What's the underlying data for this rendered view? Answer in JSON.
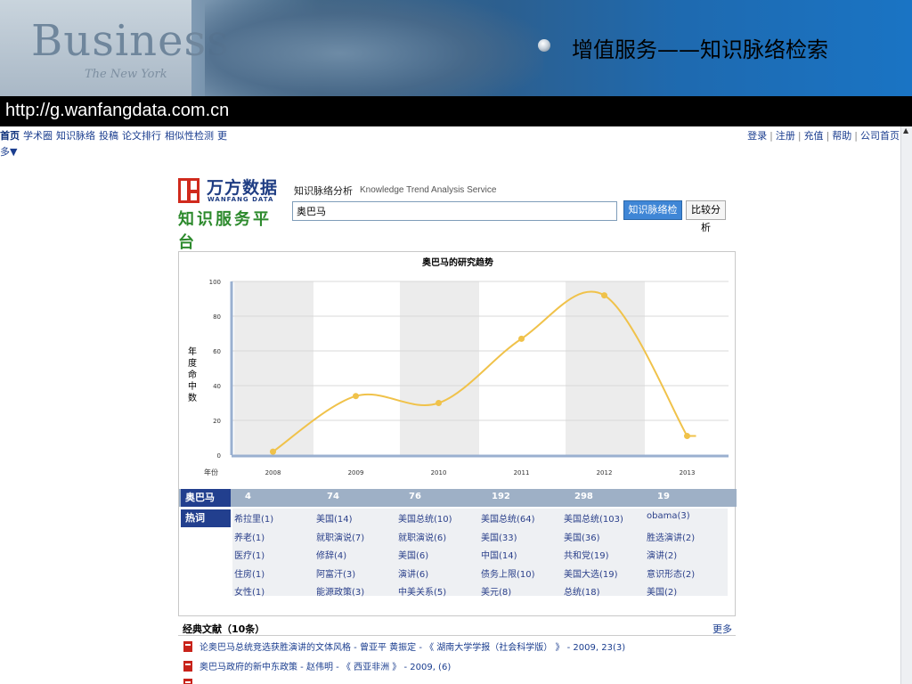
{
  "slide": {
    "banner_word": "Business",
    "banner_sub": "The New York",
    "title": "增值服务——知识脉络检索",
    "url": "http://g.wanfangdata.com.cn"
  },
  "topnav": {
    "home": "首页",
    "items": [
      "学术圈",
      "知识脉络",
      "投稿",
      "论文排行",
      "相似性检测",
      "更"
    ],
    "more_line": "多▼"
  },
  "rightnav": {
    "login": "登录",
    "register": "注册",
    "recharge": "充值",
    "help": "帮助",
    "company": "公司首页"
  },
  "logo": {
    "cn": "万方数据",
    "en": "WANFANG DATA",
    "tagline": "知识服务平台"
  },
  "service": {
    "title": "知识脉络分析",
    "subtitle_en": "Knowledge Trend Analysis Service",
    "search_value": "奥巴马",
    "search_button": "知识脉络检索",
    "compare_button": "比较分析"
  },
  "chart_data": {
    "type": "line",
    "title": "奥巴马的研究趋势",
    "ylabel": "年度命中数",
    "xlabel": "年份",
    "x": [
      "2008",
      "2009",
      "2010",
      "2011",
      "2012",
      "2013"
    ],
    "series": [
      {
        "values": [
          2,
          34,
          30,
          67,
          92,
          11
        ]
      }
    ],
    "ylim": [
      0,
      100
    ],
    "yticks": [
      "0",
      "20",
      "40",
      "60",
      "80",
      "100"
    ],
    "line_color": "#f0c24a"
  },
  "table": {
    "row_label": "奥巴马",
    "counts": [
      "4",
      "74",
      "76",
      "192",
      "298",
      "19"
    ],
    "hot_label": "热词",
    "hot_words": [
      [
        "希拉里(1)",
        "养老(1)",
        "医疗(1)",
        "住房(1)",
        "女性(1)"
      ],
      [
        "美国(14)",
        "就职演说(7)",
        "修辞(4)",
        "阿富汗(3)",
        "能源政策(3)"
      ],
      [
        "美国总统(10)",
        "就职演说(6)",
        "美国(6)",
        "演讲(6)",
        "中美关系(5)"
      ],
      [
        "美国总统(64)",
        "美国(33)",
        "中国(14)",
        "债务上限(10)",
        "美元(8)"
      ],
      [
        "美国总统(103)",
        "美国(36)",
        "共和党(19)",
        "美国大选(19)",
        "总统(18)"
      ],
      [
        "obama(3)",
        "胜选演讲(2)",
        "演讲(2)",
        "意识形态(2)",
        "美国(2)"
      ]
    ]
  },
  "classic": {
    "title": "经典文献（10条）",
    "more": "更多",
    "items": [
      "论奥巴马总统竞选获胜演讲的文体风格 - 曾亚平 黄振定 - 《 湖南大学学报（社会科学版） 》 - 2009, 23(3)",
      "奥巴马政府的新中东政策 - 赵伟明 - 《 西亚非洲 》 - 2009, (6)"
    ]
  }
}
